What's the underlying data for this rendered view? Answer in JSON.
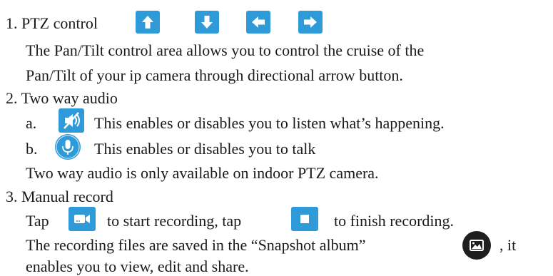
{
  "sections": {
    "ptz": {
      "heading": "1. PTZ control",
      "icons": [
        "arrow-up-icon",
        "arrow-down-icon",
        "arrow-left-icon",
        "arrow-right-icon"
      ],
      "desc_line1": "The Pan/Tilt control area allows you to control the cruise of the",
      "desc_line2": "Pan/Tilt of your ip camera through directional arrow button."
    },
    "audio": {
      "heading": "2. Two way audio",
      "item_a_marker": "a.",
      "item_a_text": "This enables or disables you to listen what’s happening.",
      "item_b_marker": "b.",
      "item_b_text": "This enables or disables you to talk",
      "note": "Two way audio is only available on indoor PTZ camera."
    },
    "record": {
      "heading": "3. Manual record",
      "tap_label": "Tap",
      "start_text": "to start recording, tap",
      "finish_text": "to finish recording.",
      "saved_text": "The recording files are saved in the “Snapshot album”",
      "saved_tail": ", it",
      "last_line": "enables you to view, edit and share."
    }
  },
  "colors": {
    "icon_blue": "#2f9ad8",
    "album_icon": "#1f1f1f",
    "text": "#1a1a1a"
  }
}
